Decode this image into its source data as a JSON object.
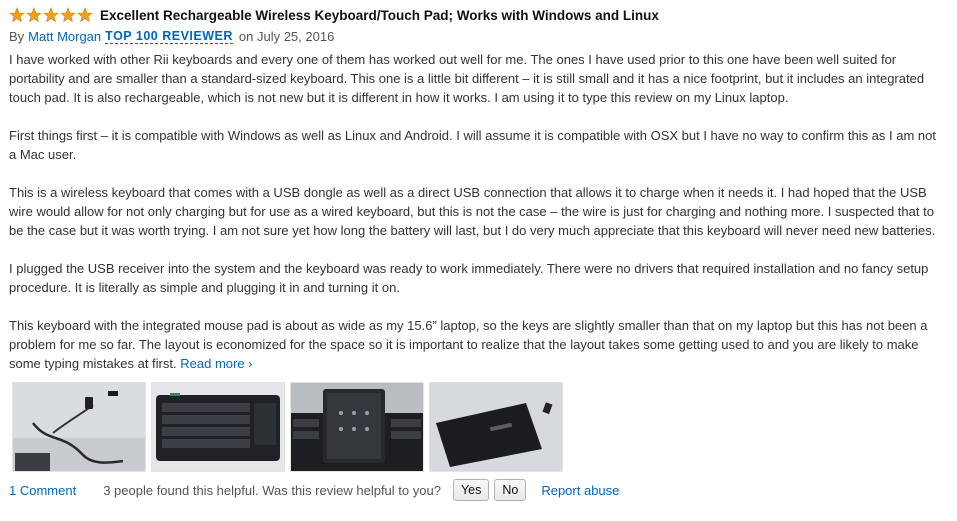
{
  "review": {
    "rating": 5,
    "title": "Excellent Rechargeable Wireless Keyboard/Touch Pad; Works with Windows and Linux",
    "by_label": "By",
    "author": "Matt Morgan",
    "badge": "TOP 100 REVIEWER",
    "date": "on July 25, 2016",
    "paragraphs": [
      "I have worked with other Rii keyboards and every one of them has worked out well for me. The ones I have used prior to this one have been well suited for portability and are smaller than a standard-sized keyboard. This one is a little bit different – it is still small and it has a nice footprint, but it includes an integrated touch pad. It is also rechargeable, which is not new but it is different in how it works. I am using it to type this review on my Linux laptop.",
      "First things first – it is compatible with Windows as well as Linux and Android. I will assume it is compatible with OSX but I have no way to confirm this as I am not a Mac user.",
      "This is a wireless keyboard that comes with a USB dongle as well as a direct USB connection that allows it to charge when it needs it. I had hoped that the USB wire would allow for not only charging but for use as a wired keyboard, but this is not the case – the wire is just for charging and nothing more. I suspected that to be the case but it was worth trying. I am not sure yet how long the battery will last, but I do very much appreciate that this keyboard will never need new batteries.",
      "I plugged the USB receiver into the system and the keyboard was ready to work immediately. There were no drivers that required installation and no fancy setup procedure. It is literally as simple and plugging it in and turning it on.",
      "This keyboard with the integrated mouse pad is about as wide as my 15.6” laptop, so the keys are slightly smaller than that on my laptop but this has not been a problem for me so far. The layout is economized for the space so it is important to realize that the layout takes some getting used to and you are likely to make some typing mistakes at first."
    ],
    "read_more": "Read more ›",
    "comments": "1 Comment",
    "helpful_text": "3 people found this helpful. Was this review helpful to you?",
    "yes_label": "Yes",
    "no_label": "No",
    "report_label": "Report abuse"
  },
  "colors": {
    "star": "#f0a01e",
    "link": "#0066c0",
    "text": "#333333"
  }
}
